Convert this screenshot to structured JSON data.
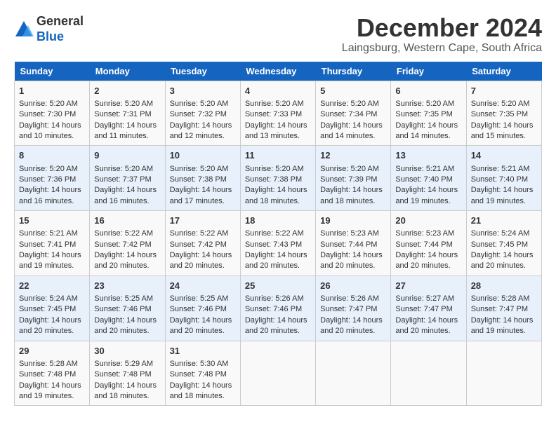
{
  "logo": {
    "general": "General",
    "blue": "Blue"
  },
  "title": "December 2024",
  "location": "Laingsburg, Western Cape, South Africa",
  "days_of_week": [
    "Sunday",
    "Monday",
    "Tuesday",
    "Wednesday",
    "Thursday",
    "Friday",
    "Saturday"
  ],
  "weeks": [
    [
      {
        "day": "1",
        "sunrise": "Sunrise: 5:20 AM",
        "sunset": "Sunset: 7:30 PM",
        "daylight": "Daylight: 14 hours and 10 minutes."
      },
      {
        "day": "2",
        "sunrise": "Sunrise: 5:20 AM",
        "sunset": "Sunset: 7:31 PM",
        "daylight": "Daylight: 14 hours and 11 minutes."
      },
      {
        "day": "3",
        "sunrise": "Sunrise: 5:20 AM",
        "sunset": "Sunset: 7:32 PM",
        "daylight": "Daylight: 14 hours and 12 minutes."
      },
      {
        "day": "4",
        "sunrise": "Sunrise: 5:20 AM",
        "sunset": "Sunset: 7:33 PM",
        "daylight": "Daylight: 14 hours and 13 minutes."
      },
      {
        "day": "5",
        "sunrise": "Sunrise: 5:20 AM",
        "sunset": "Sunset: 7:34 PM",
        "daylight": "Daylight: 14 hours and 14 minutes."
      },
      {
        "day": "6",
        "sunrise": "Sunrise: 5:20 AM",
        "sunset": "Sunset: 7:35 PM",
        "daylight": "Daylight: 14 hours and 14 minutes."
      },
      {
        "day": "7",
        "sunrise": "Sunrise: 5:20 AM",
        "sunset": "Sunset: 7:35 PM",
        "daylight": "Daylight: 14 hours and 15 minutes."
      }
    ],
    [
      {
        "day": "8",
        "sunrise": "Sunrise: 5:20 AM",
        "sunset": "Sunset: 7:36 PM",
        "daylight": "Daylight: 14 hours and 16 minutes."
      },
      {
        "day": "9",
        "sunrise": "Sunrise: 5:20 AM",
        "sunset": "Sunset: 7:37 PM",
        "daylight": "Daylight: 14 hours and 16 minutes."
      },
      {
        "day": "10",
        "sunrise": "Sunrise: 5:20 AM",
        "sunset": "Sunset: 7:38 PM",
        "daylight": "Daylight: 14 hours and 17 minutes."
      },
      {
        "day": "11",
        "sunrise": "Sunrise: 5:20 AM",
        "sunset": "Sunset: 7:38 PM",
        "daylight": "Daylight: 14 hours and 18 minutes."
      },
      {
        "day": "12",
        "sunrise": "Sunrise: 5:20 AM",
        "sunset": "Sunset: 7:39 PM",
        "daylight": "Daylight: 14 hours and 18 minutes."
      },
      {
        "day": "13",
        "sunrise": "Sunrise: 5:21 AM",
        "sunset": "Sunset: 7:40 PM",
        "daylight": "Daylight: 14 hours and 19 minutes."
      },
      {
        "day": "14",
        "sunrise": "Sunrise: 5:21 AM",
        "sunset": "Sunset: 7:40 PM",
        "daylight": "Daylight: 14 hours and 19 minutes."
      }
    ],
    [
      {
        "day": "15",
        "sunrise": "Sunrise: 5:21 AM",
        "sunset": "Sunset: 7:41 PM",
        "daylight": "Daylight: 14 hours and 19 minutes."
      },
      {
        "day": "16",
        "sunrise": "Sunrise: 5:22 AM",
        "sunset": "Sunset: 7:42 PM",
        "daylight": "Daylight: 14 hours and 20 minutes."
      },
      {
        "day": "17",
        "sunrise": "Sunrise: 5:22 AM",
        "sunset": "Sunset: 7:42 PM",
        "daylight": "Daylight: 14 hours and 20 minutes."
      },
      {
        "day": "18",
        "sunrise": "Sunrise: 5:22 AM",
        "sunset": "Sunset: 7:43 PM",
        "daylight": "Daylight: 14 hours and 20 minutes."
      },
      {
        "day": "19",
        "sunrise": "Sunrise: 5:23 AM",
        "sunset": "Sunset: 7:44 PM",
        "daylight": "Daylight: 14 hours and 20 minutes."
      },
      {
        "day": "20",
        "sunrise": "Sunrise: 5:23 AM",
        "sunset": "Sunset: 7:44 PM",
        "daylight": "Daylight: 14 hours and 20 minutes."
      },
      {
        "day": "21",
        "sunrise": "Sunrise: 5:24 AM",
        "sunset": "Sunset: 7:45 PM",
        "daylight": "Daylight: 14 hours and 20 minutes."
      }
    ],
    [
      {
        "day": "22",
        "sunrise": "Sunrise: 5:24 AM",
        "sunset": "Sunset: 7:45 PM",
        "daylight": "Daylight: 14 hours and 20 minutes."
      },
      {
        "day": "23",
        "sunrise": "Sunrise: 5:25 AM",
        "sunset": "Sunset: 7:46 PM",
        "daylight": "Daylight: 14 hours and 20 minutes."
      },
      {
        "day": "24",
        "sunrise": "Sunrise: 5:25 AM",
        "sunset": "Sunset: 7:46 PM",
        "daylight": "Daylight: 14 hours and 20 minutes."
      },
      {
        "day": "25",
        "sunrise": "Sunrise: 5:26 AM",
        "sunset": "Sunset: 7:46 PM",
        "daylight": "Daylight: 14 hours and 20 minutes."
      },
      {
        "day": "26",
        "sunrise": "Sunrise: 5:26 AM",
        "sunset": "Sunset: 7:47 PM",
        "daylight": "Daylight: 14 hours and 20 minutes."
      },
      {
        "day": "27",
        "sunrise": "Sunrise: 5:27 AM",
        "sunset": "Sunset: 7:47 PM",
        "daylight": "Daylight: 14 hours and 20 minutes."
      },
      {
        "day": "28",
        "sunrise": "Sunrise: 5:28 AM",
        "sunset": "Sunset: 7:47 PM",
        "daylight": "Daylight: 14 hours and 19 minutes."
      }
    ],
    [
      {
        "day": "29",
        "sunrise": "Sunrise: 5:28 AM",
        "sunset": "Sunset: 7:48 PM",
        "daylight": "Daylight: 14 hours and 19 minutes."
      },
      {
        "day": "30",
        "sunrise": "Sunrise: 5:29 AM",
        "sunset": "Sunset: 7:48 PM",
        "daylight": "Daylight: 14 hours and 18 minutes."
      },
      {
        "day": "31",
        "sunrise": "Sunrise: 5:30 AM",
        "sunset": "Sunset: 7:48 PM",
        "daylight": "Daylight: 14 hours and 18 minutes."
      },
      {
        "day": "",
        "sunrise": "",
        "sunset": "",
        "daylight": ""
      },
      {
        "day": "",
        "sunrise": "",
        "sunset": "",
        "daylight": ""
      },
      {
        "day": "",
        "sunrise": "",
        "sunset": "",
        "daylight": ""
      },
      {
        "day": "",
        "sunrise": "",
        "sunset": "",
        "daylight": ""
      }
    ]
  ]
}
